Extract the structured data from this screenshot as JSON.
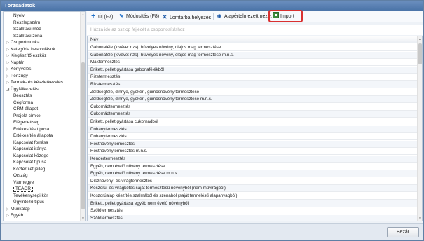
{
  "window": {
    "title": "Törzsadatok"
  },
  "sidebar": {
    "items": [
      {
        "label": "Nyelv",
        "level": 1
      },
      {
        "label": "Részlegszám",
        "level": 1
      },
      {
        "label": "Szállítási mód",
        "level": 1
      },
      {
        "label": "Szállítási zóna",
        "level": 1
      },
      {
        "label": "Csoportmunka",
        "level": 0,
        "expandable": true
      },
      {
        "label": "Kategória besorolások",
        "level": 0,
        "expandable": true
      },
      {
        "label": "Kiegészítő eszköz",
        "level": 0,
        "expandable": true
      },
      {
        "label": "Naptár",
        "level": 0,
        "expandable": true
      },
      {
        "label": "Könyvelés",
        "level": 0,
        "expandable": true
      },
      {
        "label": "Pénzügy",
        "level": 0,
        "expandable": true
      },
      {
        "label": "Termék- és készletkezelés",
        "level": 0,
        "expandable": true
      },
      {
        "label": "Ügyfélkezelés",
        "level": 0,
        "expandable": true,
        "expanded": true
      },
      {
        "label": "Beosztás",
        "level": 1
      },
      {
        "label": "Cégforma",
        "level": 1
      },
      {
        "label": "CRM állapot",
        "level": 1
      },
      {
        "label": "Projekt címke",
        "level": 1
      },
      {
        "label": "Elégedettség",
        "level": 1
      },
      {
        "label": "Értékesítés típusa",
        "level": 1
      },
      {
        "label": "Értékesítés állapota",
        "level": 1
      },
      {
        "label": "Kapcsolat forrása",
        "level": 1
      },
      {
        "label": "Kapcsolat iránya",
        "level": 1
      },
      {
        "label": "Kapcsolat közege",
        "level": 1
      },
      {
        "label": "Kapcsolat típusa",
        "level": 1
      },
      {
        "label": "Közterület jelleg",
        "level": 1
      },
      {
        "label": "Ország",
        "level": 1
      },
      {
        "label": "Vármegye",
        "level": 1
      },
      {
        "label": "TEÁOR",
        "level": 1,
        "selected": true
      },
      {
        "label": "Tevékenységi kör",
        "level": 1
      },
      {
        "label": "Ügyintéző típus",
        "level": 1
      },
      {
        "label": "Munkalap",
        "level": 0,
        "expandable": true
      },
      {
        "label": "Egyéb",
        "level": 0,
        "expandable": true
      }
    ]
  },
  "toolbar": {
    "new_label": "Új (F7)",
    "edit_label": "Módosítás (F8)",
    "delete_label": "Lomtárba helyezés",
    "default_view_label": "Alapértelmezett nézet",
    "import_label": "Import"
  },
  "grouppanel": {
    "placeholder": "Húzza ide az oszlop fejlécét a csoportosításhoz"
  },
  "grid": {
    "column_header": "Név",
    "rows": [
      "Gabonaféle (kivéve: rizs), hüvelyes növény, olajos mag termesztése",
      "Gabonaféle (kivéve: rizs), hüvelyes növény, olajos mag termesztése m.n.s.",
      "Máktermesztés",
      "Brikett, pellet gyártása gabonafélékből",
      "Rizstermesztés",
      "Rizstermesztés",
      "Zöldségféle, dinnye, gyökér-, gumósnövény termesztése",
      "Zöldségféle, dinnye, gyökér-, gumósnövény termesztése m.n.s.",
      "Cukornádtermesztés",
      "Cukornádtermesztés",
      "Brikett, pellet gyártása cukornádból",
      "Dohánytermesztés",
      "Dohánytermesztés",
      "Rostnövénytermesztés",
      "Rostnövénytermesztés m.n.s.",
      "Kendertermesztés",
      "Egyéb, nem évelő növény termesztése",
      "Egyéb, nem évelő növény termesztése m.n.s.",
      "Dísznövény- és virágtermesztés",
      "Koszorú- és virágkötés saját termesztésű növényből (nem művirágból)",
      "Koszorúalap készítés szalmából és szénából (saját termelésű alapanyagból)",
      "Brikett, pellet gyártása egyéb nem évelő növényből",
      "Szőlőtermesztés",
      "Szőlőtermesztés"
    ]
  },
  "footer": {
    "close_label": "Bezár"
  },
  "colors": {
    "titlebar": "#4b74a8",
    "import_highlight": "#d93030",
    "icon_blue": "#1e6fc8"
  }
}
